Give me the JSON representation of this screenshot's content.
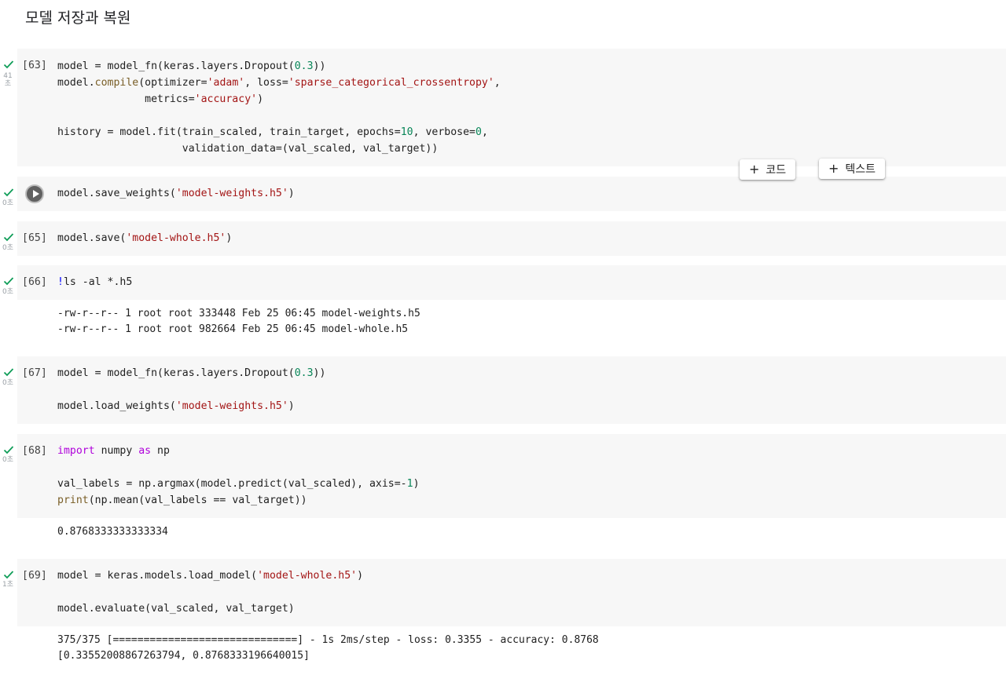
{
  "heading": "모델 저장과 복원",
  "toolbar": {
    "add_code": "코드",
    "add_text": "텍스트",
    "plus": "+"
  },
  "cells": [
    {
      "count": "[63]",
      "time": "41\n초",
      "lines": [
        "model = model_fn(keras.layers.Dropout(0.3))",
        "model.compile(optimizer='adam', loss='sparse_categorical_crossentropy',",
        "              metrics='accuracy')",
        "",
        "history = model.fit(train_scaled, train_target, epochs=10, verbose=0,",
        "                    validation_data=(val_scaled, val_target))"
      ]
    },
    {
      "count": "",
      "time": "0초",
      "lines": [
        "model.save_weights('model-weights.h5')"
      ]
    },
    {
      "count": "[65]",
      "time": "0초",
      "lines": [
        "model.save('model-whole.h5')"
      ]
    },
    {
      "count": "[66]",
      "time": "0초",
      "lines": [
        "!ls -al *.h5"
      ],
      "output": [
        "-rw-r--r-- 1 root root 333448 Feb 25 06:45 model-weights.h5",
        "-rw-r--r-- 1 root root 982664 Feb 25 06:45 model-whole.h5"
      ]
    },
    {
      "count": "[67]",
      "time": "0초",
      "lines": [
        "model = model_fn(keras.layers.Dropout(0.3))",
        "",
        "model.load_weights('model-weights.h5')"
      ]
    },
    {
      "count": "[68]",
      "time": "0초",
      "lines": [
        "import numpy as np",
        "",
        "val_labels = np.argmax(model.predict(val_scaled), axis=-1)",
        "print(np.mean(val_labels == val_target))"
      ],
      "output": [
        "0.8768333333333334"
      ]
    },
    {
      "count": "[69]",
      "time": "1초",
      "lines": [
        "model = keras.models.load_model('model-whole.h5')",
        "",
        "model.evaluate(val_scaled, val_target)"
      ],
      "output": [
        "375/375 [==============================] - 1s 2ms/step - loss: 0.3355 - accuracy: 0.8768",
        "[0.33552008867263794, 0.8768333196640015]"
      ]
    }
  ],
  "colors": {
    "string": "#a31515",
    "number": "#098658",
    "method": "#795e26",
    "keyword": "#af00db",
    "shell": "#0000ff",
    "success_check": "#0f9d58",
    "cell_background": "#f7f7f7"
  }
}
